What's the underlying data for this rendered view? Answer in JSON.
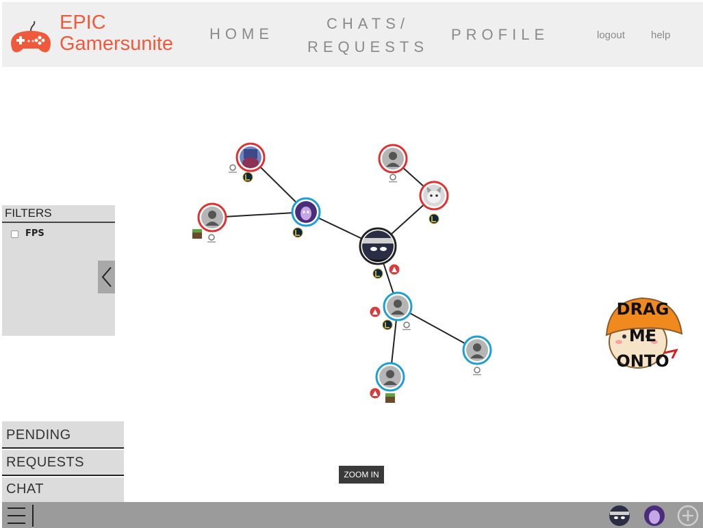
{
  "header": {
    "brand_line1": "EPIC",
    "brand_line2": "Gamersunite",
    "nav_home": "HOME",
    "nav_chats_line1": "CHATS/",
    "nav_chats_line2": "REQUESTS",
    "nav_profile": "PROFILE",
    "logout": "logout",
    "help": "help"
  },
  "filters": {
    "title": "FILTERS",
    "options": [
      {
        "label": "FPS",
        "checked": false
      }
    ]
  },
  "side_buttons": {
    "pending": "PENDING",
    "requests": "REQUESTS",
    "chat": "CHAT"
  },
  "graph": {
    "zoom_label": "ZOOM IN",
    "drag_target": {
      "line1": "DRAG",
      "line2": "ME",
      "line3": "ONTO"
    },
    "nodes": [
      {
        "id": "center",
        "ring": "#222222",
        "avatar": "ninja-avatar",
        "games": [
          "league-of-legends",
          "apex-legends"
        ]
      },
      {
        "id": "n1",
        "ring": "#1a9fd8",
        "avatar": "purple-hero-avatar",
        "games": [
          "league-of-legends"
        ]
      },
      {
        "id": "n2",
        "ring": "#e03030",
        "avatar": "armored-hero-avatar",
        "games": [
          "overwatch",
          "league-of-legends"
        ]
      },
      {
        "id": "n3",
        "ring": "#e03030",
        "avatar": "default-avatar",
        "games": [
          "minecraft",
          "overwatch"
        ]
      },
      {
        "id": "n4",
        "ring": "#e03030",
        "avatar": "default-avatar",
        "games": [
          "overwatch"
        ]
      },
      {
        "id": "n5",
        "ring": "#e03030",
        "avatar": "cat-avatar",
        "games": [
          "league-of-legends"
        ]
      },
      {
        "id": "n6",
        "ring": "#1a9fd8",
        "avatar": "default-avatar",
        "games": [
          "apex-legends",
          "league-of-legends",
          "overwatch"
        ]
      },
      {
        "id": "n7",
        "ring": "#1a9fd8",
        "avatar": "default-avatar",
        "games": [
          "overwatch"
        ]
      },
      {
        "id": "n8",
        "ring": "#1a9fd8",
        "avatar": "default-avatar",
        "games": [
          "apex-legends",
          "minecraft"
        ]
      }
    ]
  },
  "bottom_bar": {
    "icons": [
      "menu-icon",
      "friend-avatar-ninja",
      "friend-avatar-purple",
      "add-icon"
    ]
  },
  "colors": {
    "brand": "#f05a3c",
    "ring_red": "#e03030",
    "ring_blue": "#1a9fd8",
    "header_bg": "#efefef",
    "panel_bg": "#dcdcdc",
    "bottom_bar": "#9b9b9b"
  }
}
